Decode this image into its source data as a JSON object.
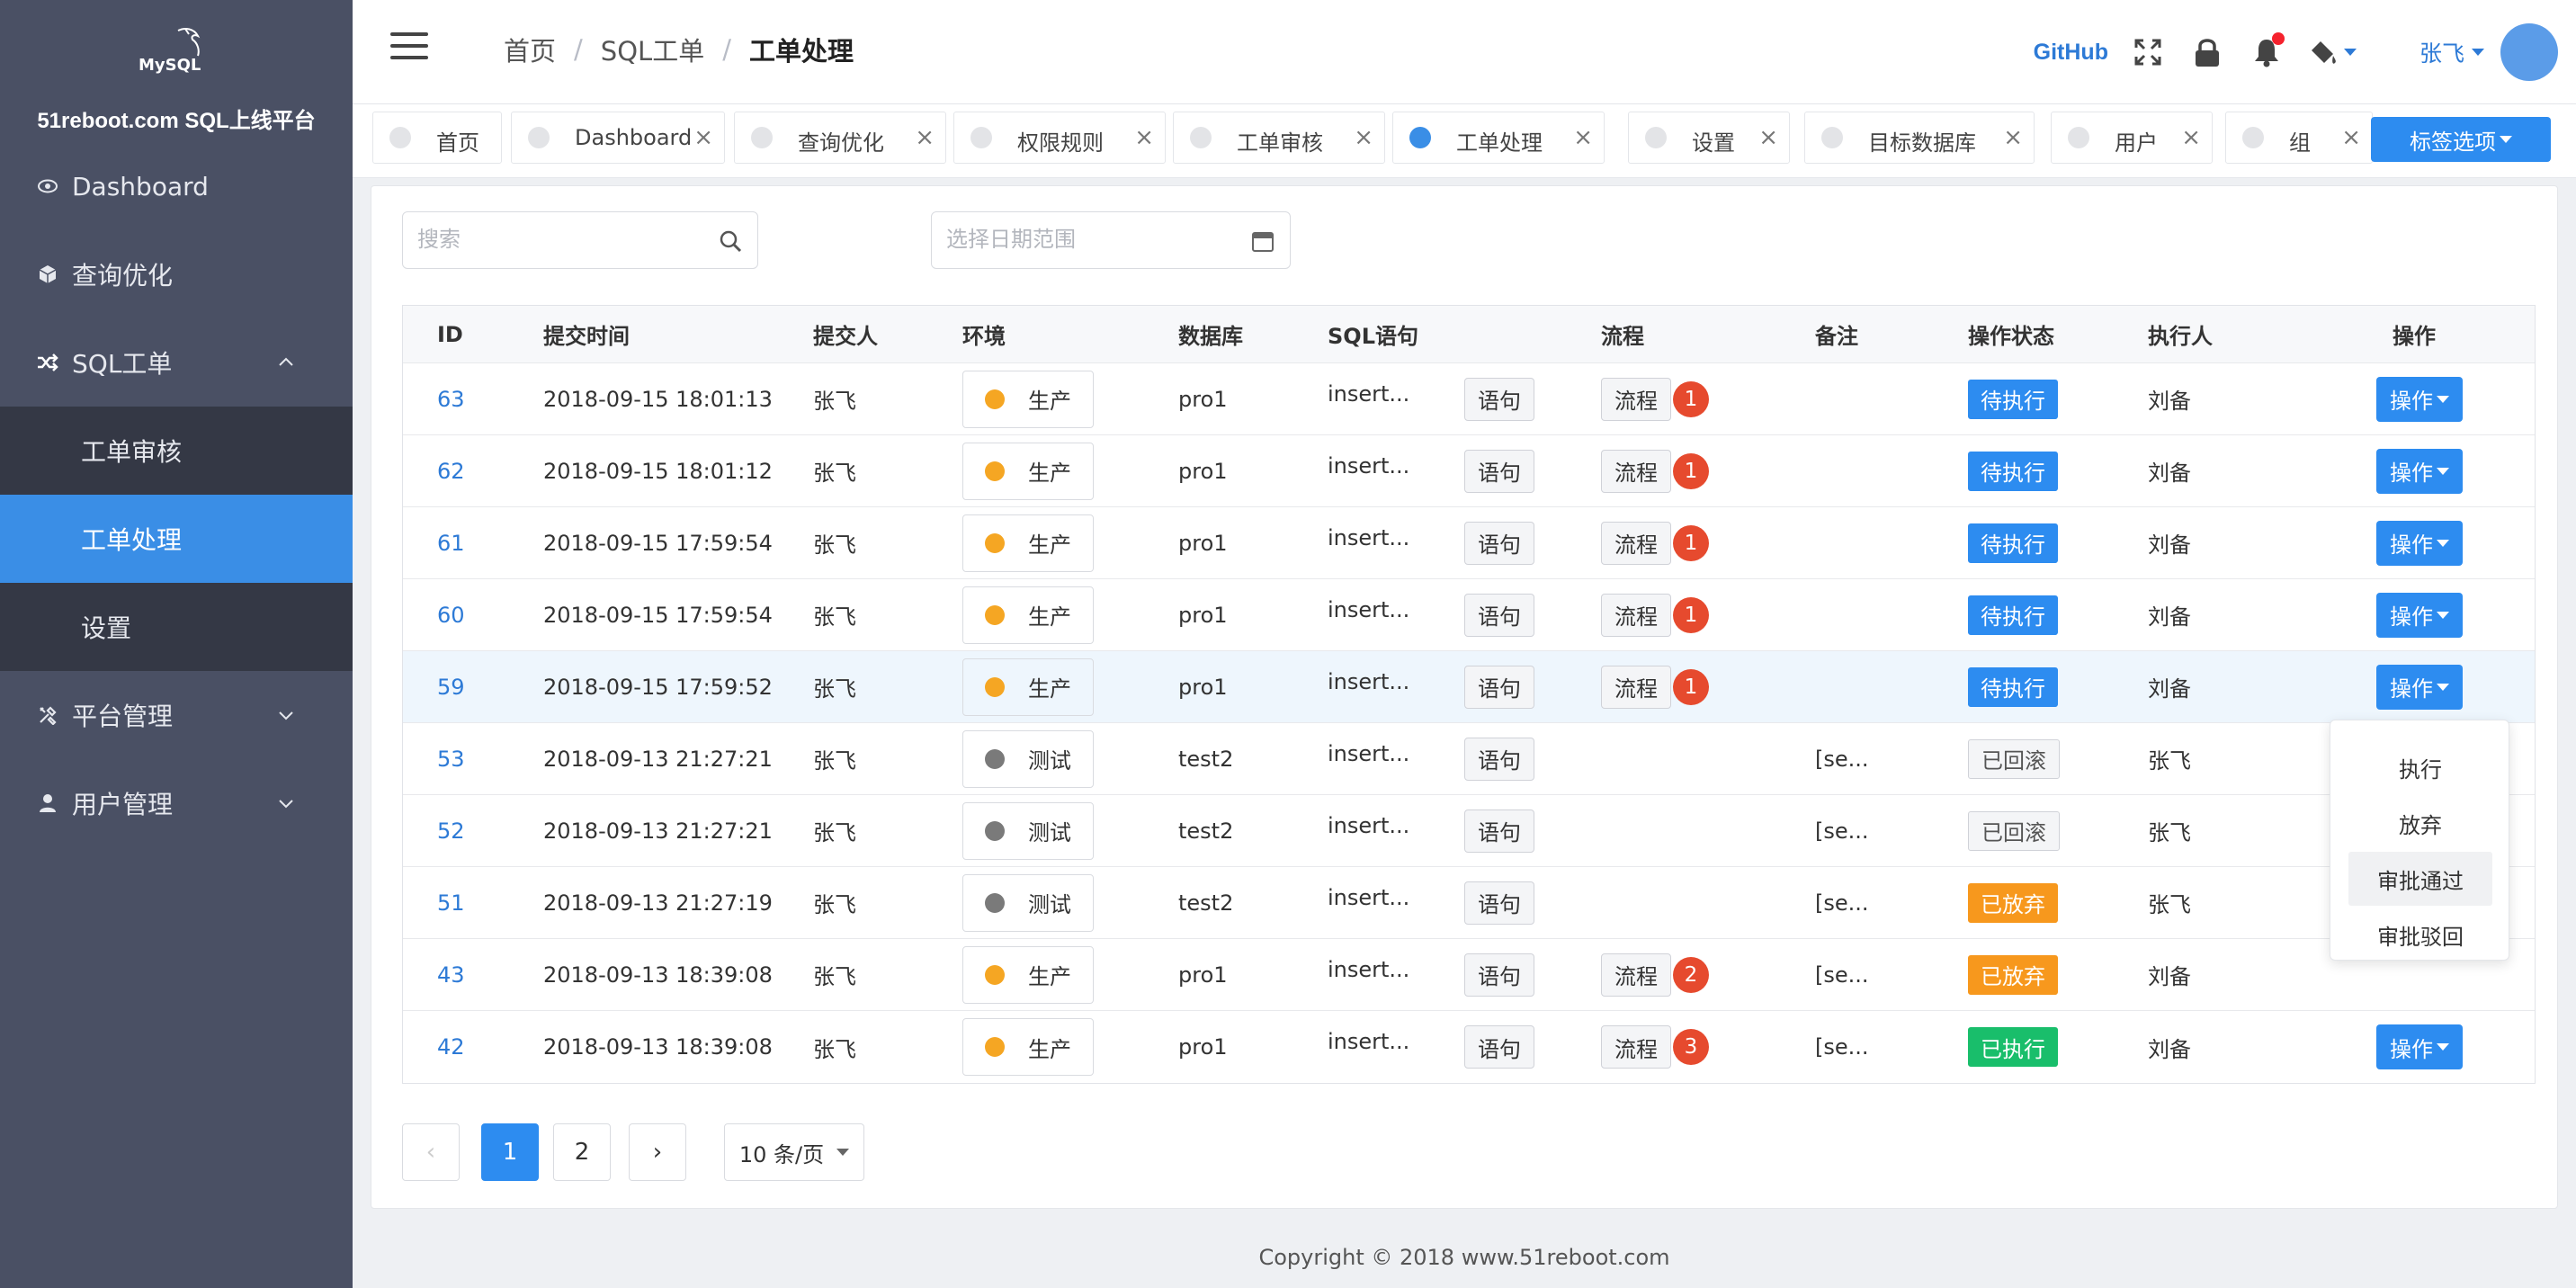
{
  "sidebar": {
    "logo_text": "MySQL",
    "platform_name": "51reboot.com SQL上线平台",
    "items": [
      {
        "label": "Dashboard",
        "icon": "eye-icon"
      },
      {
        "label": "查询优化",
        "icon": "cube-icon"
      },
      {
        "label": "SQL工单",
        "icon": "shuffle-icon"
      },
      {
        "label": "平台管理",
        "icon": "tools-icon"
      },
      {
        "label": "用户管理",
        "icon": "user-icon"
      }
    ],
    "submenu": [
      {
        "label": "工单审核"
      },
      {
        "label": "工单处理"
      },
      {
        "label": "设置"
      }
    ]
  },
  "header": {
    "breadcrumb": [
      "首页",
      "SQL工单",
      "工单处理"
    ],
    "github": "GitHub",
    "user": "张飞",
    "accent": "#2d7ad6"
  },
  "tabs": [
    {
      "label": "首页"
    },
    {
      "label": "Dashboard"
    },
    {
      "label": "查询优化"
    },
    {
      "label": "权限规则"
    },
    {
      "label": "工单审核"
    },
    {
      "label": "工单处理"
    },
    {
      "label": "设置"
    },
    {
      "label": "目标数据库"
    },
    {
      "label": "用户"
    },
    {
      "label": "组"
    }
  ],
  "tab_options": "标签选项",
  "filters": {
    "search_placeholder": "搜索",
    "date_placeholder": "选择日期范围"
  },
  "table": {
    "headers": [
      "ID",
      "提交时间",
      "提交人",
      "环境",
      "数据库",
      "SQL语句",
      "流程",
      "备注",
      "操作状态",
      "执行人",
      "操作"
    ],
    "stmt_btn": "语句",
    "flow_btn": "流程",
    "op_btn": "操作",
    "rows": [
      {
        "id": "63",
        "time": "2018-09-15 18:01:13",
        "user": "张飞",
        "env": "生产",
        "db": "pro1",
        "sql": "insert...",
        "flow": "1",
        "note": "",
        "status": "待执行",
        "executor": "刘备"
      },
      {
        "id": "62",
        "time": "2018-09-15 18:01:12",
        "user": "张飞",
        "env": "生产",
        "db": "pro1",
        "sql": "insert...",
        "flow": "1",
        "note": "",
        "status": "待执行",
        "executor": "刘备"
      },
      {
        "id": "61",
        "time": "2018-09-15 17:59:54",
        "user": "张飞",
        "env": "生产",
        "db": "pro1",
        "sql": "insert...",
        "flow": "1",
        "note": "",
        "status": "待执行",
        "executor": "刘备"
      },
      {
        "id": "60",
        "time": "2018-09-15 17:59:54",
        "user": "张飞",
        "env": "生产",
        "db": "pro1",
        "sql": "insert...",
        "flow": "1",
        "note": "",
        "status": "待执行",
        "executor": "刘备"
      },
      {
        "id": "59",
        "time": "2018-09-15 17:59:52",
        "user": "张飞",
        "env": "生产",
        "db": "pro1",
        "sql": "insert...",
        "flow": "1",
        "note": "",
        "status": "待执行",
        "executor": "刘备"
      },
      {
        "id": "53",
        "time": "2018-09-13 21:27:21",
        "user": "张飞",
        "env": "测试",
        "db": "test2",
        "sql": "insert...",
        "flow": "",
        "note": "[se...",
        "status": "已回滚",
        "executor": "张飞"
      },
      {
        "id": "52",
        "time": "2018-09-13 21:27:21",
        "user": "张飞",
        "env": "测试",
        "db": "test2",
        "sql": "insert...",
        "flow": "",
        "note": "[se...",
        "status": "已回滚",
        "executor": "张飞"
      },
      {
        "id": "51",
        "time": "2018-09-13 21:27:19",
        "user": "张飞",
        "env": "测试",
        "db": "test2",
        "sql": "insert...",
        "flow": "",
        "note": "[se...",
        "status": "已放弃",
        "executor": "张飞"
      },
      {
        "id": "43",
        "time": "2018-09-13 18:39:08",
        "user": "张飞",
        "env": "生产",
        "db": "pro1",
        "sql": "insert...",
        "flow": "2",
        "note": "[se...",
        "status": "已放弃",
        "executor": "刘备"
      },
      {
        "id": "42",
        "time": "2018-09-13 18:39:08",
        "user": "张飞",
        "env": "生产",
        "db": "pro1",
        "sql": "insert...",
        "flow": "3",
        "note": "[se...",
        "status": "已执行",
        "executor": "刘备"
      }
    ]
  },
  "env_colors": {
    "生产": "#f5a623",
    "测试": "#7a7a7a"
  },
  "status_styles": {
    "待执行": {
      "bg": "#2d8cf0",
      "fg": "#ffffff"
    },
    "已回滚": {
      "bg": "#f4f5f7",
      "fg": "#555555"
    },
    "已放弃": {
      "bg": "#f7981d",
      "fg": "#ffffff"
    },
    "已执行": {
      "bg": "#19be6b",
      "fg": "#ffffff"
    }
  },
  "dropdown": [
    "执行",
    "放弃",
    "审批通过",
    "审批驳回"
  ],
  "pagination": {
    "pages": [
      "1",
      "2"
    ],
    "current": "1",
    "page_size": "10 条/页"
  },
  "footer": "Copyright © 2018 www.51reboot.com"
}
